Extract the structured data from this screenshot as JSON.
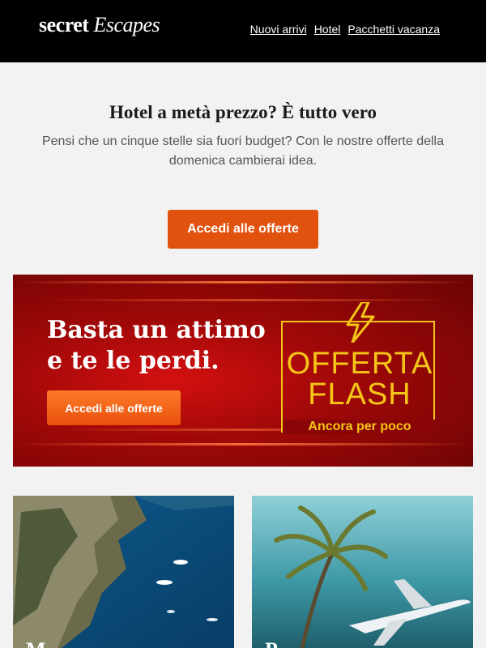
{
  "header": {
    "logo_part1": "secret",
    "logo_part2": "Escapes",
    "nav": [
      {
        "label": "Nuovi arrivi"
      },
      {
        "label": "Hotel"
      },
      {
        "label": "Pacchetti vacanza"
      }
    ]
  },
  "hero": {
    "headline": "Hotel a metà prezzo? È tutto vero",
    "subtext": "Pensi che un cinque stelle sia fuori budget? Con le nostre offerte della domenica cambierai idea.",
    "cta_label": "Accedi alle offerte"
  },
  "banner": {
    "line1": "Basta un attimo",
    "line2": "e te le perdi.",
    "button_label": "Accedi alle offerte",
    "flash_line1": "OFFERTA",
    "flash_line2": "FLASH",
    "flash_sub": "Ancora per poco",
    "accent": "#f5c518"
  },
  "cards": [
    {
      "title": "M"
    },
    {
      "title": "P"
    }
  ],
  "colors": {
    "header_bg": "#000000",
    "cta": "#e0520d",
    "background": "#f2f2f2"
  }
}
